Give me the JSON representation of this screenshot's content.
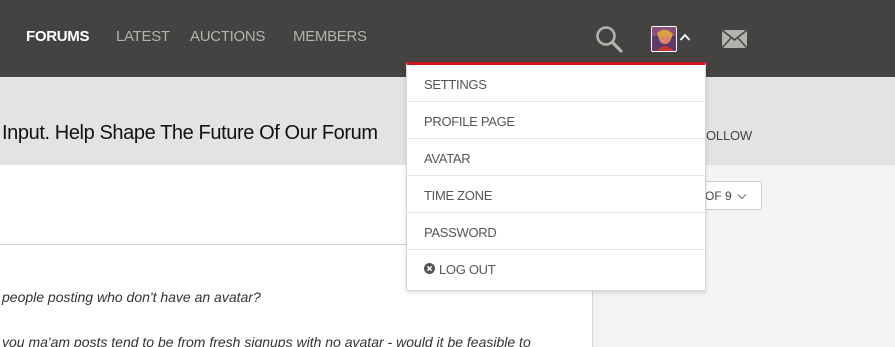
{
  "nav": {
    "items": [
      {
        "label": "FORUMS",
        "active": true
      },
      {
        "label": "LATEST",
        "active": false
      },
      {
        "label": "AUCTIONS",
        "active": false
      },
      {
        "label": "MEMBERS",
        "active": false
      }
    ],
    "icons": [
      "search-icon",
      "avatar",
      "chevron-up-icon",
      "mail-icon"
    ]
  },
  "banner": {
    "title": "Input. Help Shape The Future Of Our Forum",
    "follow_label": "OLLOW"
  },
  "pagination": {
    "label": "OF 9"
  },
  "post": {
    "line1": "people posting who don't have an avatar?",
    "line2": "you ma'am posts tend to be from fresh signups with no avatar - would it be feasible to"
  },
  "dropdown": {
    "items": [
      {
        "label": "SETTINGS"
      },
      {
        "label": "PROFILE PAGE"
      },
      {
        "label": "AVATAR"
      },
      {
        "label": "TIME ZONE"
      },
      {
        "label": "PASSWORD"
      },
      {
        "label": "LOG OUT",
        "icon": "close-circle-icon"
      }
    ]
  },
  "colors": {
    "nav_bg": "#454341",
    "accent": "#d3121f",
    "banner_bg": "#e3e3e3"
  }
}
